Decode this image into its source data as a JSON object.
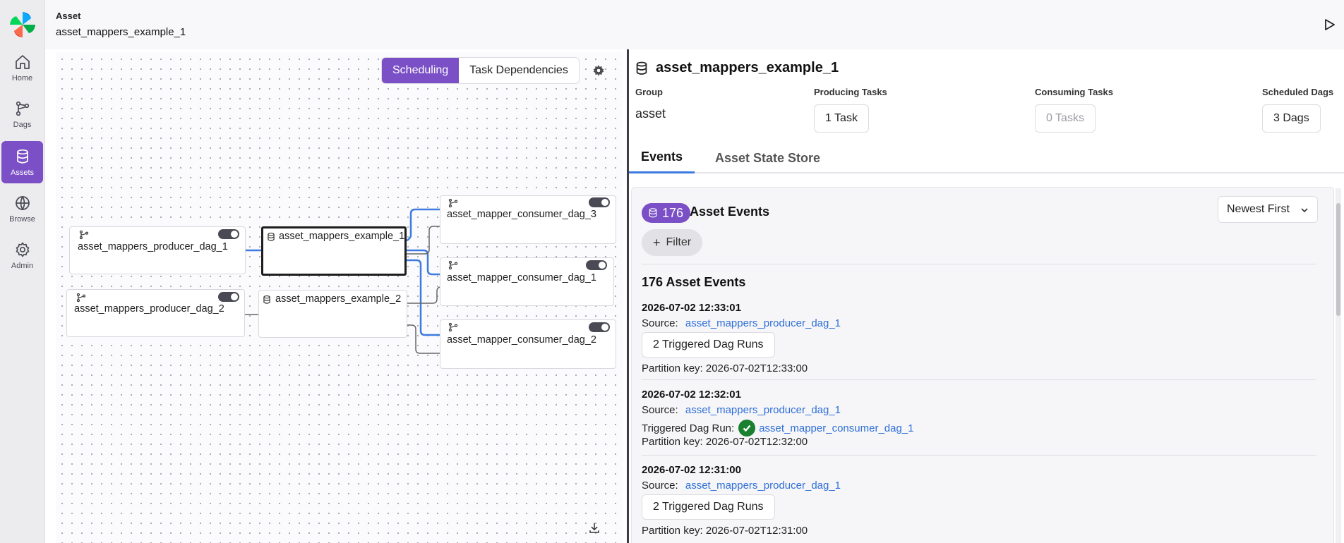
{
  "sidebar": {
    "items": [
      {
        "label": "Home",
        "icon": "home-icon"
      },
      {
        "label": "Dags",
        "icon": "dags-icon"
      },
      {
        "label": "Assets",
        "icon": "assets-icon",
        "active": true
      },
      {
        "label": "Browse",
        "icon": "globe-icon"
      },
      {
        "label": "Admin",
        "icon": "gear-icon"
      }
    ]
  },
  "header": {
    "section": "Asset",
    "title": "asset_mappers_example_1"
  },
  "graph": {
    "toggle": {
      "scheduling": "Scheduling",
      "task_dependencies": "Task Dependencies",
      "active": "Scheduling"
    },
    "nodes": {
      "producer_1": "asset_mappers_producer_dag_1",
      "producer_2": "asset_mappers_producer_dag_2",
      "asset_1": "asset_mappers_example_1",
      "asset_2": "asset_mappers_example_2",
      "consumer_3": "asset_mapper_consumer_dag_3",
      "consumer_1": "asset_mapper_consumer_dag_1",
      "consumer_2": "asset_mapper_consumer_dag_2"
    },
    "colors": {
      "highlight_edge": "#3d7be0",
      "edge": "#555555"
    }
  },
  "detail": {
    "title": "asset_mappers_example_1",
    "group_label": "Group",
    "group_value": "asset",
    "producing_label": "Producing Tasks",
    "producing_value": "1 Task",
    "consuming_label": "Consuming Tasks",
    "consuming_value": "0 Tasks",
    "scheduled_label": "Scheduled Dags",
    "scheduled_value": "3 Dags",
    "tabs": [
      {
        "label": "Events",
        "active": true
      },
      {
        "label": "Asset State Store",
        "active": false
      }
    ],
    "events": {
      "count": "176",
      "title": "Asset Events",
      "filter_label": "Filter",
      "sort_value": "Newest First",
      "list_heading": "176 Asset Events",
      "source_label": "Source:",
      "items": [
        {
          "timestamp": "2026-07-02 12:33:01",
          "source": "asset_mappers_producer_dag_1",
          "triggered": "2 Triggered Dag Runs",
          "partition": "Partition key: 2026-07-02T12:33:00"
        },
        {
          "timestamp": "2026-07-02 12:32:01",
          "source": "asset_mappers_producer_dag_1",
          "triggered_label": "Triggered Dag Run:",
          "triggered_link": "asset_mapper_consumer_dag_1",
          "partition": "Partition key: 2026-07-02T12:32:00"
        },
        {
          "timestamp": "2026-07-02 12:31:00",
          "source": "asset_mappers_producer_dag_1",
          "triggered": "2 Triggered Dag Runs",
          "partition": "Partition key: 2026-07-02T12:31:00"
        }
      ]
    }
  },
  "colors": {
    "accent": "#7b4fc5",
    "link": "#2f6fd6",
    "success": "#1a7f2e"
  }
}
